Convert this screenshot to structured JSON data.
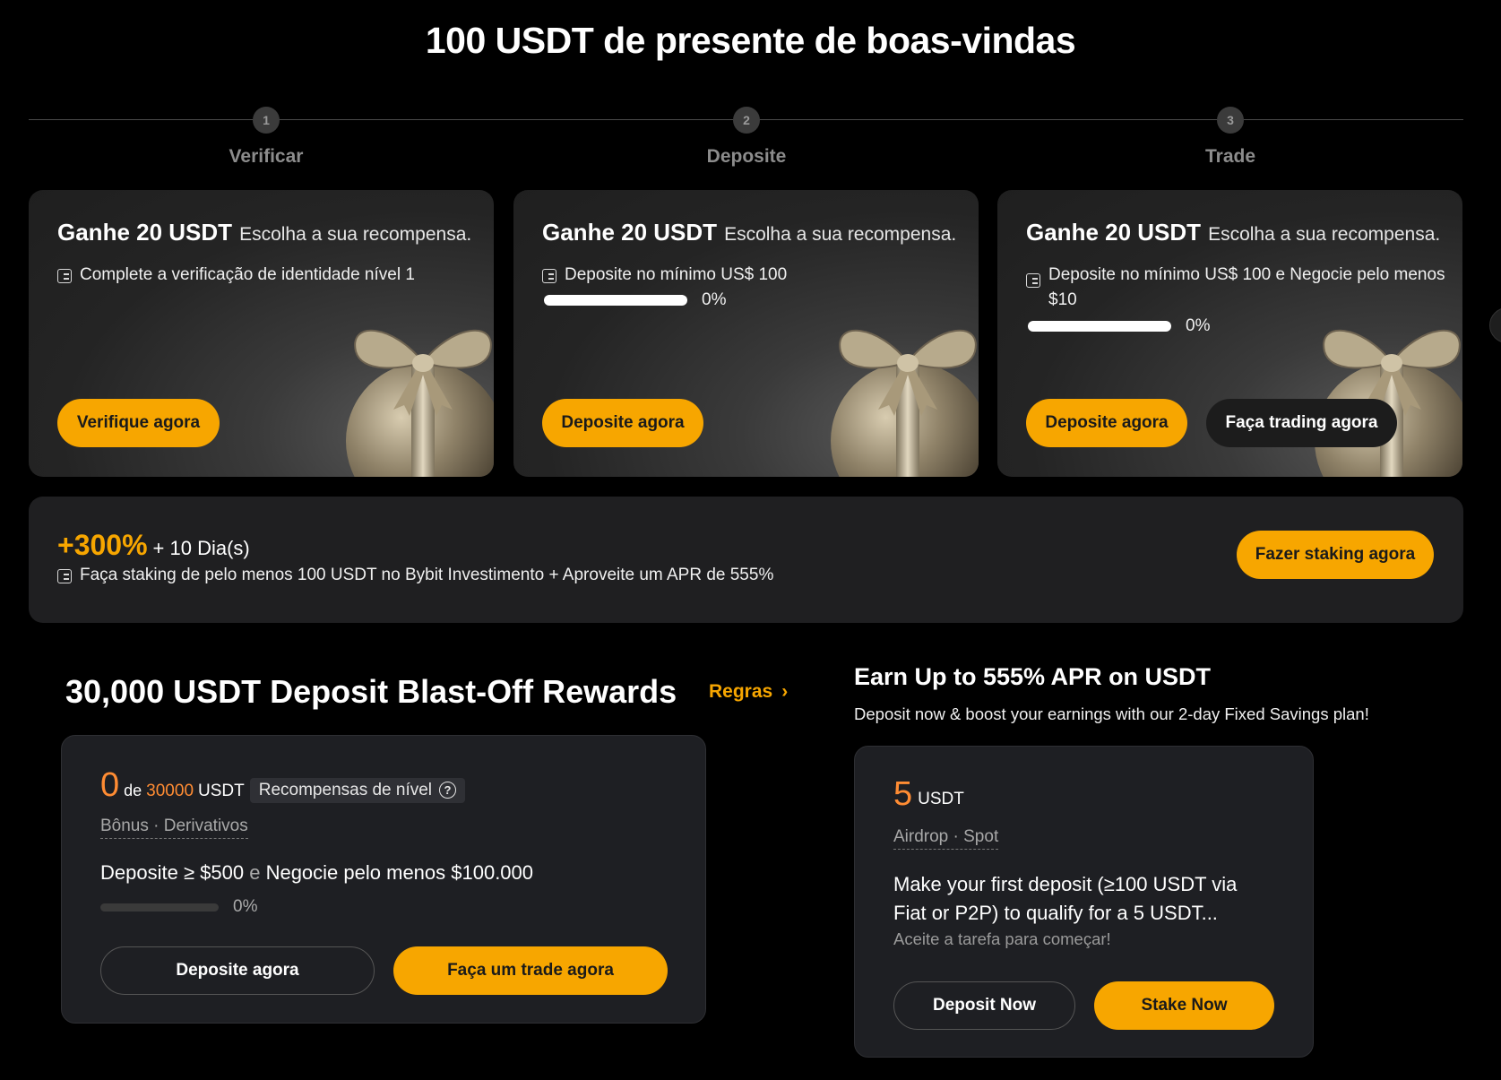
{
  "page_title": "100 USDT de presente de boas-vindas",
  "steps": [
    {
      "num": "1",
      "label": "Verificar"
    },
    {
      "num": "2",
      "label": "Deposite"
    },
    {
      "num": "3",
      "label": "Trade"
    }
  ],
  "cards": [
    {
      "amount": "Ganhe 20 USDT",
      "sub": "Escolha a sua recompensa.",
      "task": "Complete a verificação de identidade nível 1",
      "button": "Verifique agora"
    },
    {
      "amount": "Ganhe 20 USDT",
      "sub": "Escolha a sua recompensa.",
      "task": "Deposite no mínimo US$ 100",
      "progress": "0%",
      "button": "Deposite agora"
    },
    {
      "amount": "Ganhe 20 USDT",
      "sub": "Escolha a sua recompensa.",
      "task": "Deposite no mínimo US$ 100 e Negocie pelo menos $10",
      "progress": "0%",
      "button": "Deposite agora",
      "button2": "Faça trading agora"
    }
  ],
  "staking": {
    "pct": "+300%",
    "days": "+ 10 Dia(s)",
    "task": "Faça staking de pelo menos 100 USDT no Bybit Investimento + Aproveite um APR de 555%",
    "button": "Fazer staking agora"
  },
  "blast": {
    "title": "30,000 USDT Deposit Blast-Off Rewards",
    "rules": "Regras",
    "current": "0",
    "of": "de",
    "total": "30000",
    "unit": "USDT",
    "badge": "Recompensas de nível",
    "tags": "Bônus · Derivativos",
    "task_deposit": "Deposite ≥ $500",
    "task_and": "e",
    "task_trade": "Negocie pelo menos $100.000",
    "progress": "0%",
    "btn_deposit": "Deposite agora",
    "btn_trade": "Faça um trade agora"
  },
  "earn": {
    "title": "Earn Up to 555% APR on USDT",
    "subtitle": "Deposit now & boost your earnings with our 2-day Fixed Savings plan!",
    "amount": "5",
    "unit": "USDT",
    "tags": "Airdrop · Spot",
    "desc_line1": "Make your first deposit (≥100 USDT via",
    "desc_line2": "Fiat or P2P) to qualify for a 5 USDT...",
    "hint": "Aceite a tarefa para começar!",
    "btn_deposit": "Deposit Now",
    "btn_stake": "Stake Now"
  },
  "colors": {
    "accent": "#f7a600",
    "orange_num": "#ff8c33",
    "bg": "#000000"
  }
}
